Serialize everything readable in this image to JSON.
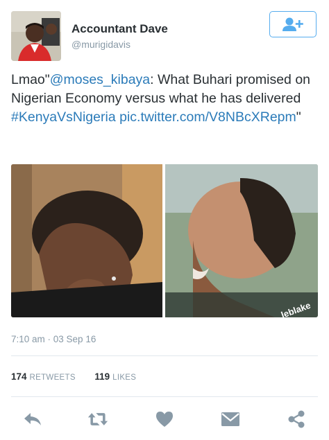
{
  "user": {
    "name": "Accountant Dave",
    "handle": "@murigidavis"
  },
  "tweet": {
    "prefix": "Lmao\"",
    "mention": "@moses_kibaya",
    "body": ": What Buhari promised on Nigerian Economy versus what he has delivered ",
    "hashtag": "#KenyaVsNigeria",
    "link": "pic.twitter.com/V8NBcXRepm",
    "suffix": "\""
  },
  "media": {
    "watermark": "leblake"
  },
  "meta": {
    "timestamp": "7:10 am · 03 Sep 16"
  },
  "stats": {
    "retweets_count": "174",
    "retweets_label": "RETWEETS",
    "likes_count": "119",
    "likes_label": "LIKES"
  },
  "icons": {
    "follow": "add-user-icon",
    "reply": "reply-icon",
    "retweet": "retweet-icon",
    "like": "heart-icon",
    "message": "envelope-icon",
    "share": "share-icon"
  },
  "colors": {
    "accent": "#55acee",
    "link": "#2b7bb9",
    "muted": "#8899a6",
    "action_icon": "#8899a6"
  }
}
